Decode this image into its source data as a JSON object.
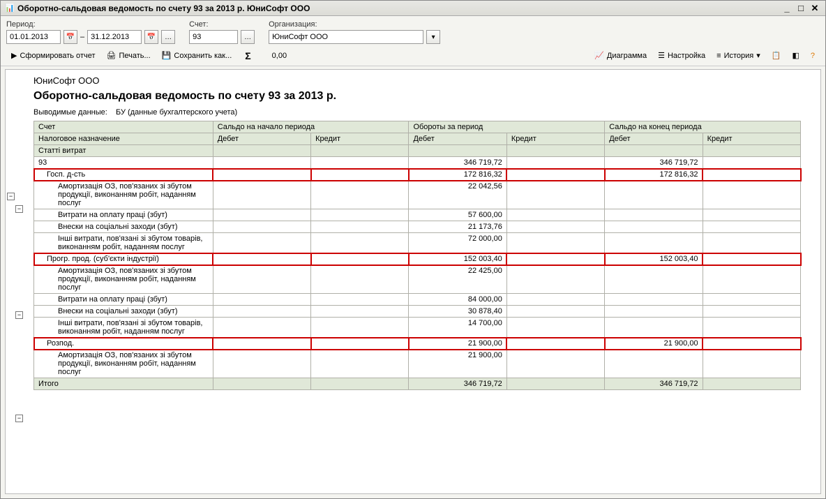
{
  "window": {
    "title": "Оборотно-сальдовая ведомость по счету 93 за 2013 р. ЮниСофт ООО"
  },
  "filters": {
    "period_label": "Период:",
    "date_from": "01.01.2013",
    "date_sep": "–",
    "date_to": "31.12.2013",
    "account_label": "Счет:",
    "account": "93",
    "org_label": "Организация:",
    "org": "ЮниСофт ООО"
  },
  "toolbar": {
    "form": "Сформировать отчет",
    "print": "Печать...",
    "save": "Сохранить как...",
    "sum_sign": "Σ",
    "sum_val": "0,00",
    "diagram": "Диаграмма",
    "settings": "Настройка",
    "history": "История"
  },
  "report": {
    "org": "ЮниСофт ООО",
    "title": "Оборотно-сальдовая ведомость по счету 93 за 2013 р.",
    "output_label": "Выводимые данные:",
    "output_value": "БУ (данные бухгалтерского учета)"
  },
  "headers": {
    "account": "Счет",
    "begin": "Сальдо на начало периода",
    "turn": "Обороты за период",
    "end": "Сальдо на конец периода",
    "tax": "Налоговое назначение",
    "cost": "Статті витрат",
    "debit": "Дебет",
    "credit": "Кредит"
  },
  "rows": [
    {
      "lvl": 0,
      "name": "93",
      "bd": "",
      "bc": "",
      "td": "346 719,72",
      "tc": "",
      "ed": "346 719,72",
      "ec": "",
      "hl": false
    },
    {
      "lvl": 1,
      "name": "Госп. д-сть",
      "bd": "",
      "bc": "",
      "td": "172 816,32",
      "tc": "",
      "ed": "172 816,32",
      "ec": "",
      "hl": true
    },
    {
      "lvl": 2,
      "name": "Амортизація ОЗ, пов'язаних зі збутом продукції, виконанням робіт, наданням послуг",
      "bd": "",
      "bc": "",
      "td": "22 042,56",
      "tc": "",
      "ed": "",
      "ec": "",
      "hl": false
    },
    {
      "lvl": 2,
      "name": "Витрати на оплату праці (збут)",
      "bd": "",
      "bc": "",
      "td": "57 600,00",
      "tc": "",
      "ed": "",
      "ec": "",
      "hl": false
    },
    {
      "lvl": 2,
      "name": "Внески на соціальні заходи (збут)",
      "bd": "",
      "bc": "",
      "td": "21 173,76",
      "tc": "",
      "ed": "",
      "ec": "",
      "hl": false
    },
    {
      "lvl": 2,
      "name": "Інші витрати, пов'язані зі збутом товарів, виконанням робіт, наданням послуг",
      "bd": "",
      "bc": "",
      "td": "72 000,00",
      "tc": "",
      "ed": "",
      "ec": "",
      "hl": false
    },
    {
      "lvl": 1,
      "name": "Прогр. прод. (суб'єкти індустрії)",
      "bd": "",
      "bc": "",
      "td": "152 003,40",
      "tc": "",
      "ed": "152 003,40",
      "ec": "",
      "hl": true
    },
    {
      "lvl": 2,
      "name": "Амортизація ОЗ, пов'язаних зі збутом продукції, виконанням робіт, наданням послуг",
      "bd": "",
      "bc": "",
      "td": "22 425,00",
      "tc": "",
      "ed": "",
      "ec": "",
      "hl": false
    },
    {
      "lvl": 2,
      "name": "Витрати на оплату праці (збут)",
      "bd": "",
      "bc": "",
      "td": "84 000,00",
      "tc": "",
      "ed": "",
      "ec": "",
      "hl": false
    },
    {
      "lvl": 2,
      "name": "Внески на соціальні заходи (збут)",
      "bd": "",
      "bc": "",
      "td": "30 878,40",
      "tc": "",
      "ed": "",
      "ec": "",
      "hl": false
    },
    {
      "lvl": 2,
      "name": "Інші витрати, пов'язані зі збутом товарів, виконанням робіт, наданням послуг",
      "bd": "",
      "bc": "",
      "td": "14 700,00",
      "tc": "",
      "ed": "",
      "ec": "",
      "hl": false
    },
    {
      "lvl": 1,
      "name": "Розпод.",
      "bd": "",
      "bc": "",
      "td": "21 900,00",
      "tc": "",
      "ed": "21 900,00",
      "ec": "",
      "hl": true
    },
    {
      "lvl": 2,
      "name": "Амортизація ОЗ, пов'язаних зі збутом продукції, виконанням робіт, наданням послуг",
      "bd": "",
      "bc": "",
      "td": "21 900,00",
      "tc": "",
      "ed": "",
      "ec": "",
      "hl": false
    }
  ],
  "total": {
    "name": "Итого",
    "bd": "",
    "bc": "",
    "td": "346 719,72",
    "tc": "",
    "ed": "346 719,72",
    "ec": ""
  }
}
